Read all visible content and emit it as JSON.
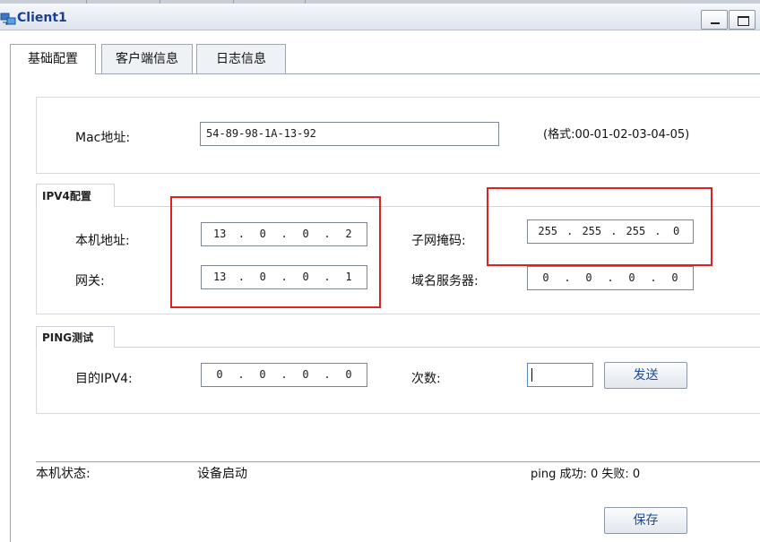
{
  "window": {
    "title": "Client1"
  },
  "tabs": [
    "基础配置",
    "客户端信息",
    "日志信息"
  ],
  "mac": {
    "label": "Mac地址:",
    "value": "54-89-98-1A-13-92",
    "hint": "(格式:00-01-02-03-04-05)"
  },
  "ipv4": {
    "legend": "IPV4配置",
    "host_label": "本机地址:",
    "host": [
      "13",
      "0",
      "0",
      "2"
    ],
    "mask_label": "子网掩码:",
    "mask": [
      "255",
      "255",
      "255",
      "0"
    ],
    "gateway_label": "网关:",
    "gateway": [
      "13",
      "0",
      "0",
      "1"
    ],
    "dns_label": "域名服务器:",
    "dns": [
      "0",
      "0",
      "0",
      "0"
    ]
  },
  "ping": {
    "legend": "PING测试",
    "dest_label": "目的IPV4:",
    "dest": [
      "0",
      "0",
      "0",
      "0"
    ],
    "count_label": "次数:",
    "count_value": "",
    "send_label": "发送"
  },
  "status": {
    "label": "本机状态:",
    "value": "设备启动",
    "ping_result": "ping 成功: 0 失败: 0"
  },
  "save_label": "保存",
  "colors": {
    "highlight": "#e02020",
    "title_text": "#1b3f8f",
    "button_text": "#1c4e9d"
  }
}
